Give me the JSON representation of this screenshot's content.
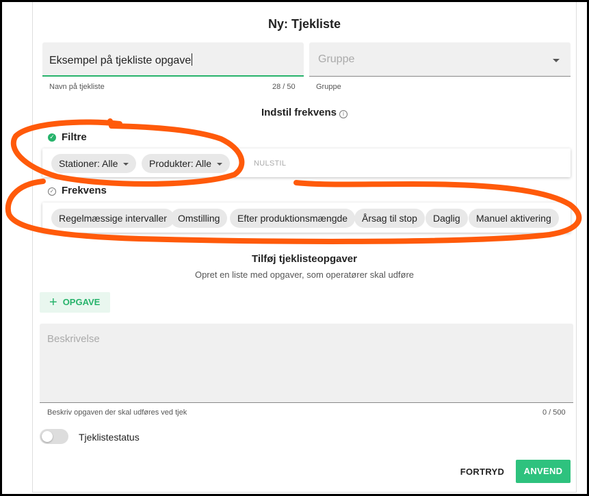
{
  "dialog": {
    "title": "Ny: Tjekliste"
  },
  "name_field": {
    "value": "Eksempel på tjekliste opgave",
    "label": "Navn på tjekliste",
    "counter": "28 / 50"
  },
  "group_field": {
    "placeholder": "Gruppe",
    "label": "Gruppe"
  },
  "frequency": {
    "heading": "Indstil frekvens"
  },
  "filters": {
    "title": "Filtre",
    "chips": [
      {
        "label": "Stationer: Alle"
      },
      {
        "label": "Produkter: Alle"
      }
    ],
    "reset_label": "NULSTIL"
  },
  "frekvens": {
    "title": "Frekvens",
    "chips": [
      {
        "label": "Regelmæssige intervaller"
      },
      {
        "label": "Omstilling"
      },
      {
        "label": "Efter produktionsmængde"
      },
      {
        "label": "Årsag til stop"
      },
      {
        "label": "Daglig"
      },
      {
        "label": "Manuel aktivering"
      }
    ]
  },
  "tasks": {
    "heading": "Tilføj tjeklisteopgaver",
    "subheading": "Opret en liste med opgaver, som operatører skal udføre",
    "add_button": "OPGAVE",
    "description_placeholder": "Beskrivelse",
    "description_helper": "Beskriv opgaven der skal udføres ved tjek",
    "description_counter": "0 / 500"
  },
  "status": {
    "label": "Tjeklistestatus",
    "enabled": false
  },
  "actions": {
    "cancel": "FORTRYD",
    "apply": "ANVEND"
  },
  "colors": {
    "accent": "#27b36b",
    "annotation": "#ff5a0a"
  }
}
